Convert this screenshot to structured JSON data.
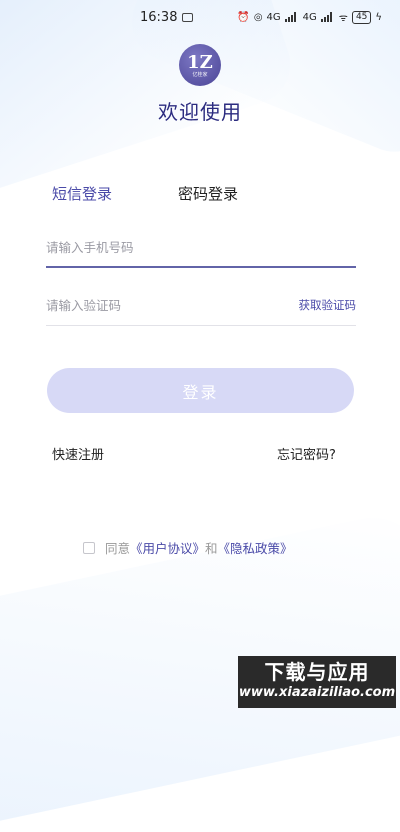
{
  "status_bar": {
    "time": "16:38",
    "battery": "45",
    "network_labels": [
      "4G",
      "4G"
    ]
  },
  "logo": {
    "mark": "1Z",
    "subtitle": "亿桂家"
  },
  "welcome_title": "欢迎使用",
  "tabs": [
    {
      "label": "短信登录",
      "active": true
    },
    {
      "label": "密码登录",
      "active": false
    }
  ],
  "phone_field": {
    "placeholder": "请输入手机号码",
    "value": ""
  },
  "code_field": {
    "placeholder": "请输入验证码",
    "value": ""
  },
  "get_code_label": "获取验证码",
  "login_label": "登录",
  "register_label": "快速注册",
  "forgot_label": "忘记密码?",
  "agreement": {
    "checked": false,
    "prefix": "同意",
    "user_agreement": "《用户协议》",
    "and": "和",
    "privacy_policy": "《隐私政策》"
  },
  "watermark": {
    "title": "下载与应用",
    "url": "www.xiazaiziliao.com"
  },
  "colors": {
    "accent": "#4a4aa8",
    "title": "#2c2c80",
    "button_disabled": "#d7d9f6",
    "watermark_bg": "#2a2a2a"
  }
}
